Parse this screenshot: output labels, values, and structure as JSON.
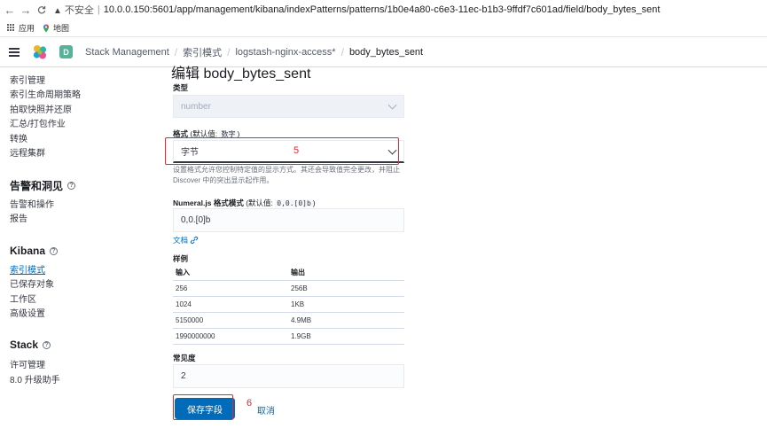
{
  "browser": {
    "back_glyph": "←",
    "forward_glyph": "→",
    "reload_glyph": "C",
    "warning_glyph": "▲",
    "insecure_label": "不安全",
    "separator": "|",
    "url": "10.0.0.150:5601/app/management/kibana/indexPatterns/patterns/1b0e4a80-c6e3-11ec-b1b3-9ffdf7c601ad/field/body_bytes_sent",
    "bookmarks": [
      {
        "label": "应用",
        "icon": "apps-grid-icon"
      },
      {
        "label": "地图",
        "icon": "maps-icon"
      }
    ]
  },
  "header": {
    "space_initial": "D",
    "breadcrumbs": [
      "Stack Management",
      "索引模式",
      "logstash-nginx-access*",
      "body_bytes_sent"
    ],
    "breadcrumb_separator": "/"
  },
  "sidebar": {
    "group_ingest_items": [
      "索引管理",
      "索引生命周期策略",
      "拍取快照并还原",
      "汇总/打包作业",
      "转换",
      "远程集群"
    ],
    "alerts_title": "告警和洞见",
    "alerts_items": [
      "告警和操作",
      "报告"
    ],
    "kibana_title": "Kibana",
    "kibana_items": [
      "索引模式",
      "已保存对象",
      "工作区",
      "高级设置"
    ],
    "stack_title": "Stack",
    "stack_items": [
      "许可管理",
      "8.0 升级助手"
    ],
    "help_glyph": "?"
  },
  "form": {
    "cut_title": "编辑 body_bytes_sent",
    "type_label": "类型",
    "type_value": "number",
    "format_label": "格式",
    "format_default_prefix": "(默认值: ",
    "format_default_value": "数字",
    "format_default_suffix": ")",
    "format_value": "字节",
    "format_help": "设置格式允许您控制特定值的显示方式。其还会导致值完全更改，并阻止 Discover 中的突出显示起作用。",
    "numeral_label": "Numeral.js 格式模式",
    "numeral_default_prefix": "(默认值: ",
    "numeral_default_value": "0,0.[0]b",
    "numeral_default_suffix": ")",
    "numeral_value": "0,0.[0]b",
    "docs_link": "文档",
    "samples_label": "样例",
    "samples_headers": [
      "输入",
      "输出"
    ],
    "samples_rows": [
      [
        "256",
        "256B"
      ],
      [
        "1024",
        "1KB"
      ],
      [
        "5150000",
        "4.9MB"
      ],
      [
        "1990000000",
        "1.9GB"
      ]
    ],
    "popularity_label": "常见度",
    "popularity_value": "2",
    "save_label": "保存字段",
    "cancel_label": "取消"
  },
  "annotations": {
    "step5": "5",
    "step6": "6",
    "color": "#e8262b"
  },
  "colors": {
    "accent": "#006bb8",
    "space_badge": "#54b399"
  }
}
